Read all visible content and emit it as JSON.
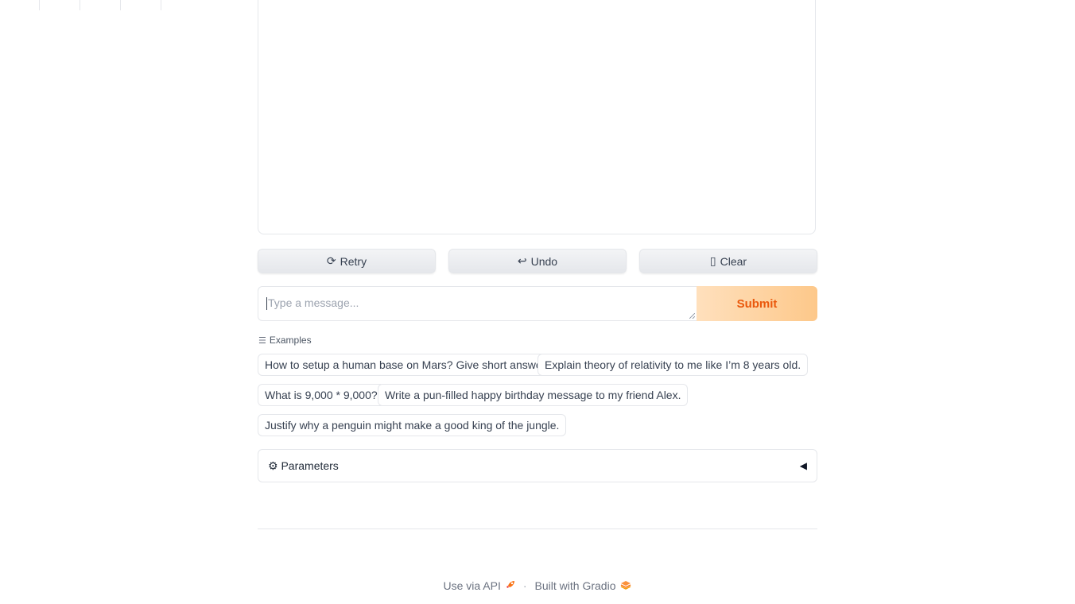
{
  "buttons": {
    "retry_icon": "⟳",
    "retry_label": "Retry",
    "undo_icon": "↩",
    "undo_label": "Undo",
    "clear_icon": "▯",
    "clear_label": "Clear"
  },
  "input": {
    "placeholder": "Type a message...",
    "value": ""
  },
  "submit_label": "Submit",
  "examples": {
    "label": "Examples",
    "items": [
      "How to setup a human base on Mars? Give short answer.",
      "Explain theory of relativity to me like I’m 8 years old.",
      "What is 9,000 * 9,000?",
      "Write a pun-filled happy birthday message to my friend Alex.",
      "Justify why a penguin might make a good king of the jungle."
    ]
  },
  "parameters": {
    "icon": "⚙",
    "label": "Parameters",
    "toggle": "◀"
  },
  "footer": {
    "api_label": "Use via API",
    "separator": "·",
    "built_label": "Built with Gradio"
  },
  "colors": {
    "accent": "#ea580c",
    "submit_gradient_start": "#ffe0bd",
    "submit_gradient_end": "#fdc88a"
  }
}
